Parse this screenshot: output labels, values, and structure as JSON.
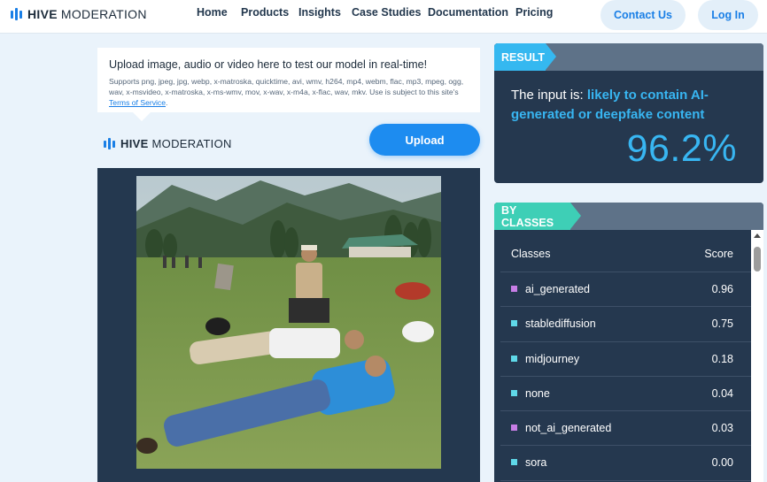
{
  "brand": {
    "bold": "HIVE",
    "light": "MODERATION"
  },
  "nav": {
    "links": [
      "Home",
      "Products",
      "Insights",
      "Case Studies",
      "Documentation",
      "Pricing"
    ],
    "contact": "Contact Us",
    "login": "Log In"
  },
  "upload": {
    "title": "Upload image, audio or video here to test our model in real-time!",
    "supports": "Supports png, jpeg, jpg, webp, x-matroska, quicktime, avi, wmv, h264, mp4, webm, flac, mp3, mpeg, ogg, wav, x-msvideo, x-matroska, x-ms-wmv, mov, x-wav, x-m4a, x-flac, wav, mkv. Use is subject to this site's ",
    "terms_link": "Terms of Service",
    "terms_suffix": ".",
    "button": "Upload"
  },
  "result": {
    "tag": "RESULT",
    "prefix": "The input is: ",
    "verdict": "likely to contain AI-generated or deepfake content",
    "percent": "96.2%"
  },
  "by_classes": {
    "tag": "BY CLASSES",
    "header_class": "Classes",
    "header_score": "Score",
    "rows": [
      {
        "name": "ai_generated",
        "score": "0.96",
        "color": "#c77ee6"
      },
      {
        "name": "stablediffusion",
        "score": "0.75",
        "color": "#5fd8e8"
      },
      {
        "name": "midjourney",
        "score": "0.18",
        "color": "#5fd8e8"
      },
      {
        "name": "none",
        "score": "0.04",
        "color": "#5fd8e8"
      },
      {
        "name": "not_ai_generated",
        "score": "0.03",
        "color": "#c77ee6"
      },
      {
        "name": "sora",
        "score": "0.00",
        "color": "#5fd8e8"
      }
    ]
  },
  "colors": {
    "accent_blue": "#1d8cf0",
    "result_cyan": "#38b6f2",
    "classes_teal": "#3ecfb6",
    "panel_navy": "#25384f"
  }
}
